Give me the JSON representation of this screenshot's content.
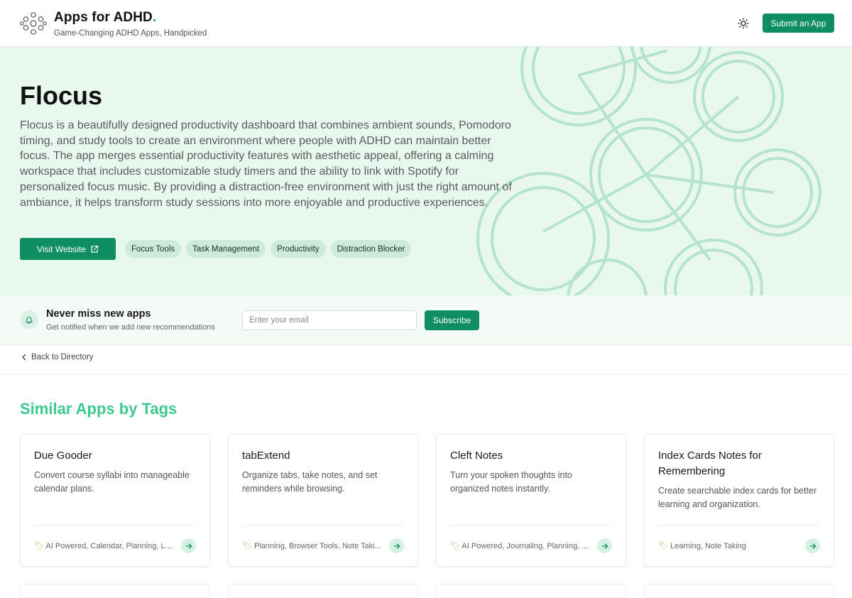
{
  "header": {
    "brand_title": "Apps for ADHD",
    "brand_dot": ".",
    "brand_subtitle": "Game-Changing ADHD Apps, Handpicked",
    "theme_icon": "sun-icon",
    "submit_label": "Submit an App"
  },
  "hero": {
    "title": "Flocus",
    "description": "Flocus is a beautifully designed productivity dashboard that combines ambient sounds, Pomodoro timing, and study tools to create an environment where people with ADHD can maintain better focus. The app merges essential productivity features with aesthetic appeal, offering a calming workspace that includes customizable study timers and the ability to link with Spotify for personalized focus music. By providing a distraction-free environment with just the right amount of ambiance, it helps transform study sessions into more enjoyable and productive experiences.",
    "visit_label": "Visit Website",
    "tags": [
      "Focus Tools",
      "Task Management",
      "Productivity",
      "Distraction Blocker"
    ]
  },
  "newsletter": {
    "title": "Never miss new apps",
    "subtitle": "Get notified when we add new recommendations",
    "placeholder": "Enter your email",
    "button": "Subscribe"
  },
  "nav": {
    "back_label": "Back to Directory"
  },
  "similar": {
    "title": "Similar Apps by Tags",
    "cards": [
      {
        "title": "Due Gooder",
        "description": "Convert course syllabi into manageable calendar plans.",
        "tags": "AI Powered, Calendar, Planning, L..."
      },
      {
        "title": "tabExtend",
        "description": "Organize tabs, take notes, and set reminders while browsing.",
        "tags": "Planning, Browser Tools, Note Taki..."
      },
      {
        "title": "Cleft Notes",
        "description": "Turn your spoken thoughts into organized notes instantly.",
        "tags": "AI Powered, Journaling, Planning, ..."
      },
      {
        "title": "Index Cards Notes for Remembering",
        "description": "Create searchable index cards for better learning and organization.",
        "tags": "Learning, Note Taking"
      }
    ]
  },
  "colors": {
    "brand_green": "#0f8d63",
    "accent_green": "#3ec98e",
    "hero_bg": "#e8f8ef",
    "tag_bg": "#cdebd9"
  }
}
